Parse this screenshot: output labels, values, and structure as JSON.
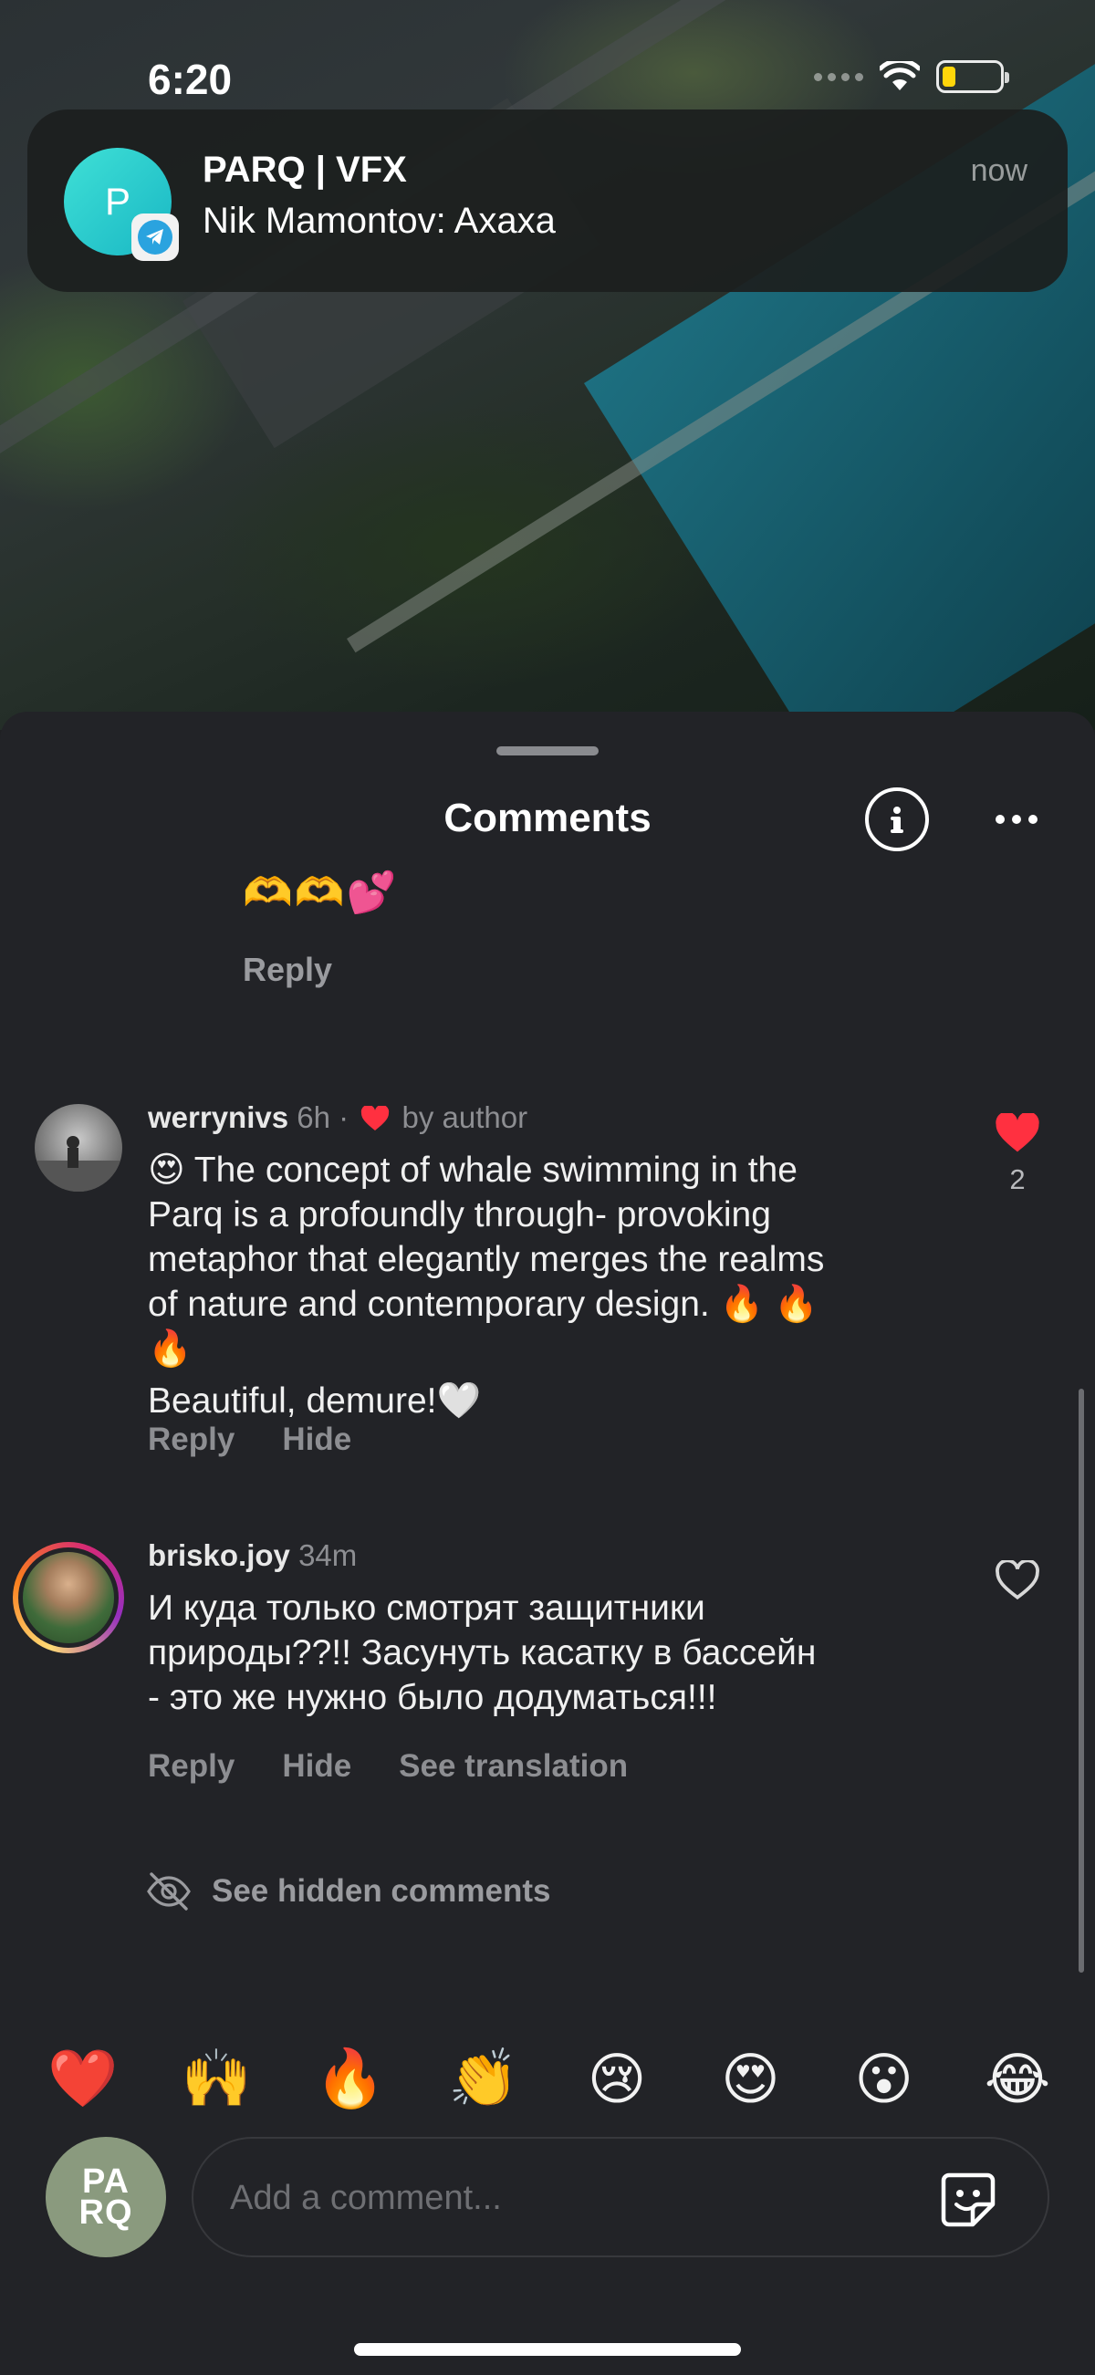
{
  "status_bar": {
    "time": "6:20",
    "battery_color": "#ffd60a"
  },
  "notification": {
    "avatar_letter": "P",
    "app_icon": "telegram-icon",
    "title": "PARQ | VFX",
    "body": "Nik Mamontov: Axaxa",
    "time": "now"
  },
  "sheet": {
    "title": "Comments",
    "info_icon": "info-icon",
    "more_icon": "more-horizontal-icon"
  },
  "previous_comment": {
    "emojis": "🫶🫶💕",
    "reply_label": "Reply"
  },
  "comments": [
    {
      "username": "werrynivs",
      "time": "6h",
      "separator": "·",
      "liked_by_author_label": "by author",
      "text_lines": [
        "😍 The concept of whale swimming in the",
        "Parq is a profoundly through- provoking",
        "metaphor that elegantly merges the realms",
        "of nature and contemporary design. 🔥 🔥",
        "🔥"
      ],
      "text_extra": "Beautiful, demure!🤍",
      "actions": {
        "reply": "Reply",
        "hide": "Hide"
      },
      "liked": true,
      "like_count": "2"
    },
    {
      "username": "brisko.joy",
      "time": "34m",
      "text_lines": [
        "И куда только смотрят защитники",
        "природы??!! Засунуть касатку в бассейн",
        "- это же нужно было додуматься!!!"
      ],
      "actions": {
        "reply": "Reply",
        "hide": "Hide",
        "translate": "See translation"
      },
      "liked": false
    }
  ],
  "hidden_comments_label": "See hidden comments",
  "reactions": [
    "❤️",
    "🙌",
    "🔥",
    "👏",
    "😢",
    "😍",
    "😮",
    "😂"
  ],
  "composer": {
    "avatar_text_top": "PA",
    "avatar_text_bottom": "RQ",
    "placeholder": "Add a comment..."
  },
  "colors": {
    "like_red": "#ff3040",
    "sheet_bg": "#222327",
    "muted_text": "#8d8e92"
  }
}
